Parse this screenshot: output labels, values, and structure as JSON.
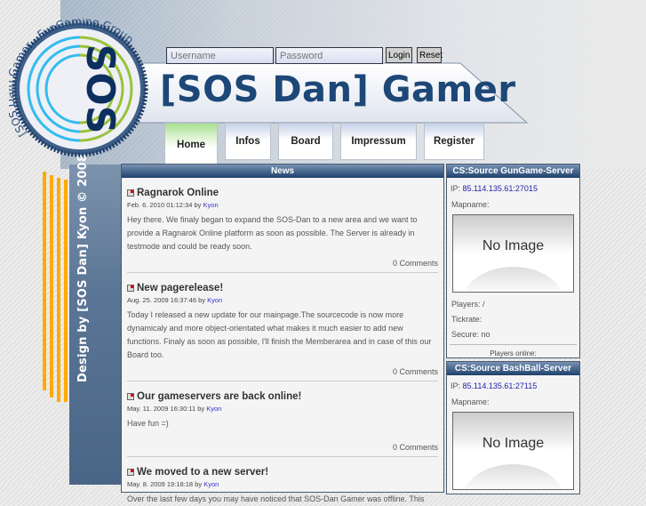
{
  "logo": {
    "ring_text": "[SOS Dan] Gamer - FunGaming Group",
    "letters": "SOS"
  },
  "header": {
    "title": "[SOS Dan] Gamer",
    "username_placeholder": "Username",
    "password_placeholder": "Password",
    "login_label": "Login",
    "reset_label": "Reset"
  },
  "nav": {
    "tabs": [
      {
        "label": "Home"
      },
      {
        "label": "Infos"
      },
      {
        "label": "Board"
      },
      {
        "label": "Impressum"
      },
      {
        "label": "Register"
      }
    ]
  },
  "sidebar": {
    "credit": "Design by [SOS Dan] Kyon © 2008"
  },
  "news": {
    "heading": "News",
    "items": [
      {
        "title": "Ragnarok Online",
        "date": "Feb. 6. 2010 01:12:34",
        "by": "by",
        "author": "Kyon",
        "body": "Hey there. We finaly began to expand the SOS-Dan to a new area and we want to provide a Ragnarok Online platform as soon as possible. The Server is already in testmode and could be ready soon.",
        "comments": "0 Comments"
      },
      {
        "title": "New pagerelease!",
        "date": "Aug. 25. 2009 16:37:46",
        "by": "by",
        "author": "Kyon",
        "body": "Today I released a new update for our mainpage.The sourcecode is now more dynamicaly and more object-orientated what makes it much easier to add new functions. Finaly as soon as possible, I'll finish the Memberarea and in case of this our Board too.",
        "comments": "0 Comments"
      },
      {
        "title": "Our gameservers are back online!",
        "date": "May. 11. 2009 16:30:11",
        "by": "by",
        "author": "Kyon",
        "body": "Have fun =)",
        "comments": "0 Comments"
      },
      {
        "title": "We moved to a new server!",
        "date": "May. 8. 2009 19:18:18",
        "by": "by",
        "author": "Kyon",
        "body": "Over the last few days you may have noticed that SOS-Dan Gamer was offline. This",
        "comments": ""
      }
    ]
  },
  "servers": [
    {
      "name": "CS:Source GunGame-Server",
      "ip_label": "IP:",
      "ip": "85.114.135.61:27015",
      "mapname": "Mapname:",
      "image": "No Image",
      "players": "Players: /",
      "tickrate": "Tickrate:",
      "secure": "Secure: no",
      "online": "Players online:"
    },
    {
      "name": "CS:Source BashBall-Server",
      "ip_label": "IP:",
      "ip": "85.114.135.61:27115",
      "mapname": "Mapname:",
      "image": "No Image"
    }
  ]
}
